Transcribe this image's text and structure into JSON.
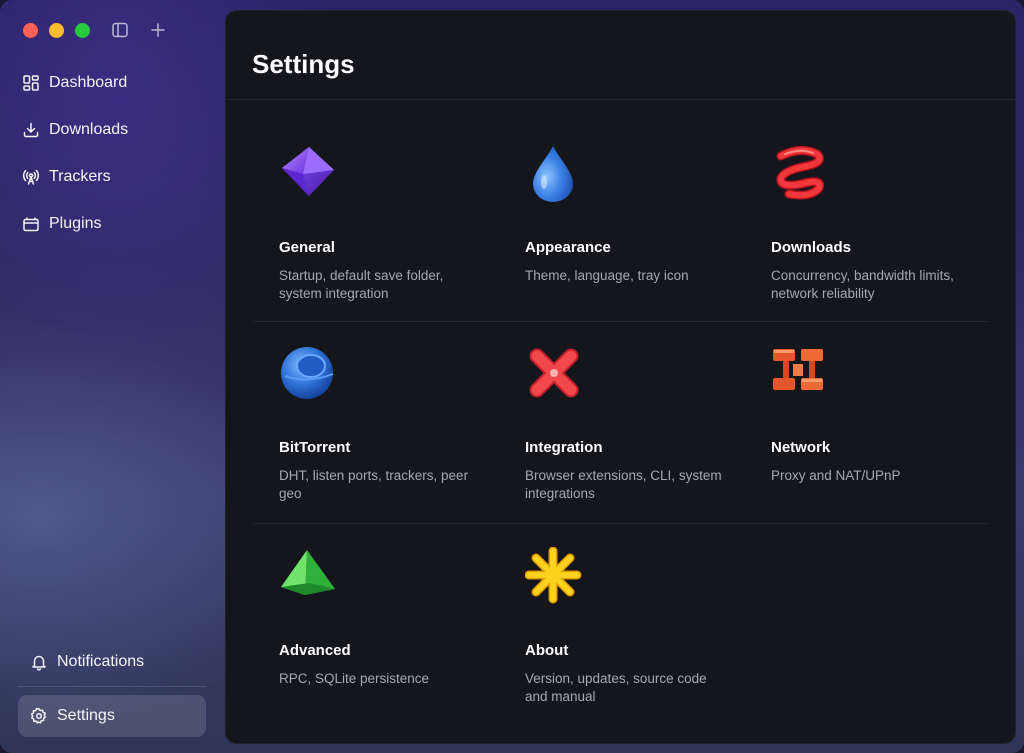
{
  "titlebar": {
    "controls": [
      "close",
      "minimize",
      "maximize"
    ],
    "icons": [
      "sidebar-toggle-icon",
      "plus-icon"
    ]
  },
  "sidebar": {
    "items": [
      {
        "label": "Dashboard",
        "icon": "dashboard-icon"
      },
      {
        "label": "Downloads",
        "icon": "download-icon"
      },
      {
        "label": "Trackers",
        "icon": "broadcast-icon"
      },
      {
        "label": "Plugins",
        "icon": "plugin-icon"
      }
    ],
    "bottom_items": [
      {
        "label": "Notifications",
        "icon": "bell-icon"
      },
      {
        "label": "Settings",
        "icon": "gear-icon",
        "active": true
      }
    ]
  },
  "main": {
    "title": "Settings",
    "cards": [
      {
        "title": "General",
        "description": "Startup, default save folder, system integration",
        "icon": "purple-octahedron-icon"
      },
      {
        "title": "Appearance",
        "description": "Theme, language, tray icon",
        "icon": "blue-drop-icon"
      },
      {
        "title": "Downloads",
        "description": "Concurrency, bandwidth limits, network reliability",
        "icon": "red-spiral-icon"
      },
      {
        "title": "BitTorrent",
        "description": "DHT, listen ports, trackers, peer geo",
        "icon": "blue-sphere-icon"
      },
      {
        "title": "Integration",
        "description": "Browser extensions, CLI, system integrations",
        "icon": "red-cross-icon"
      },
      {
        "title": "Network",
        "description": "Proxy and NAT/UPnP",
        "icon": "orange-network-icon"
      },
      {
        "title": "Advanced",
        "description": "RPC, SQLite persistence",
        "icon": "green-pyramid-icon"
      },
      {
        "title": "About",
        "description": "Version, updates, source code and manual",
        "icon": "yellow-asterisk-icon"
      }
    ]
  },
  "colors": {
    "close": "#fe5f57",
    "minimize": "#febc2e",
    "maximize": "#28c840",
    "panel_bg": "#15151c",
    "desc_text": "#a7a7b3"
  }
}
